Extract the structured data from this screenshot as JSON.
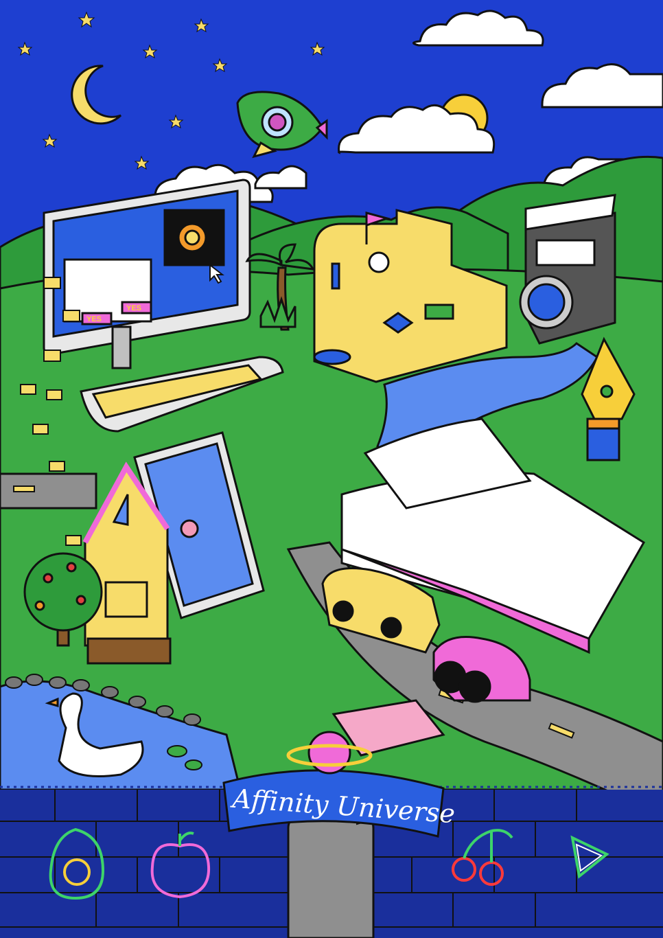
{
  "banner": {
    "title": "Affinity Universe"
  },
  "screen": {
    "button_left": "YES",
    "button_right": "YES"
  },
  "colors": {
    "sky": "#1e3fd0",
    "grass": "#3dab45",
    "hill": "#2e9b3b",
    "wall": "#1a2f9c",
    "road": "#8f8f8f",
    "water": "#5b8cf0",
    "outline": "#111111",
    "pink": "#f06ad8",
    "yellow": "#f7dc6a"
  },
  "icons": [
    "moon-icon",
    "sun-icon",
    "star-icon",
    "rocket-icon",
    "planet-icon",
    "avocado-icon",
    "peach-icon",
    "cherry-icon",
    "watermelon-icon",
    "envelope-icon",
    "cursor-icon",
    "pen-nib-icon"
  ]
}
